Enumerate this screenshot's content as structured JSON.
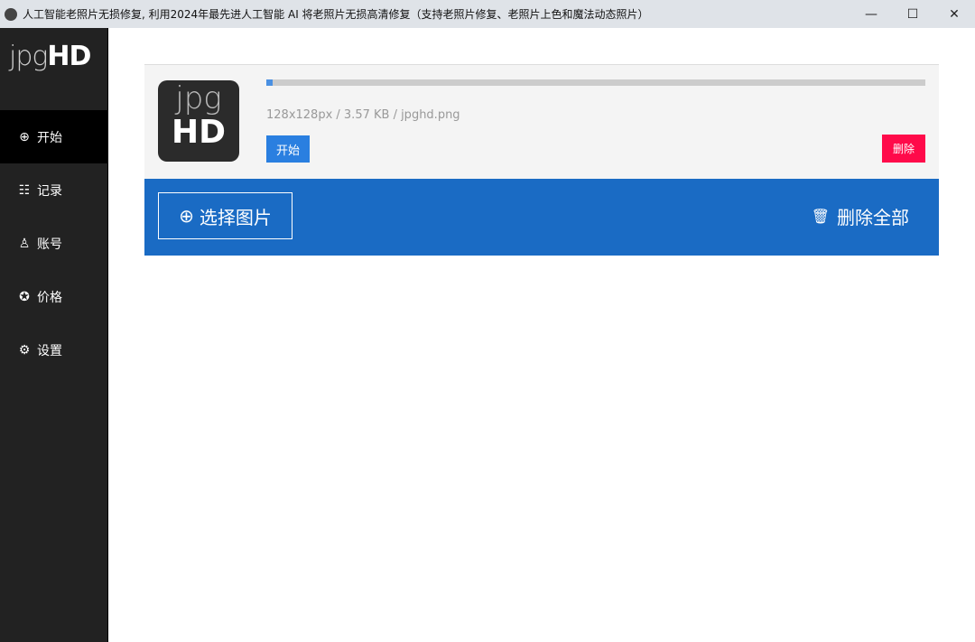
{
  "window": {
    "title": "人工智能老照片无损修复, 利用2024年最先进人工智能 AI 将老照片无损高清修复（支持老照片修复、老照片上色和魔法动态照片）",
    "minimize": "—",
    "maximize": "☐",
    "close": "✕"
  },
  "logo": {
    "light": "jpg",
    "bold": "HD"
  },
  "sidebar": {
    "items": [
      {
        "label": "开始",
        "icon": "plus-circle"
      },
      {
        "label": "记录",
        "icon": "list"
      },
      {
        "label": "账号",
        "icon": "user"
      },
      {
        "label": "价格",
        "icon": "award"
      },
      {
        "label": "设置",
        "icon": "gear"
      }
    ]
  },
  "file": {
    "thumb_top": "jpg",
    "thumb_bottom": "HD",
    "info": "128x128px / 3.57 KB / jpghd.png",
    "progress_percent": 1,
    "start_label": "开始",
    "delete_label": "删除"
  },
  "actions": {
    "choose_label": "选择图片",
    "delete_all_label": "删除全部"
  },
  "colors": {
    "accent": "#1a6bc4",
    "start": "#2a7fe0",
    "delete": "#ff0a4a"
  }
}
